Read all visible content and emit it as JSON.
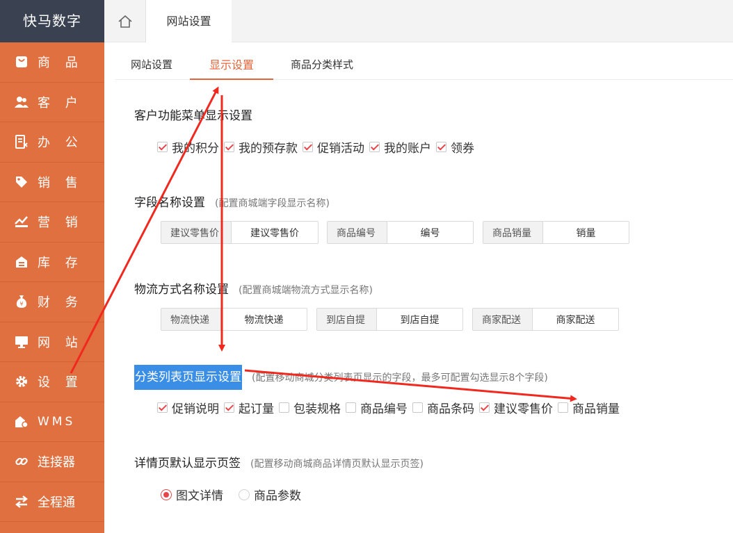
{
  "sidebar": {
    "brand": "快马数字",
    "items": [
      {
        "label": "商 品",
        "icon": "bag-icon"
      },
      {
        "label": "客 户",
        "icon": "users-icon"
      },
      {
        "label": "办 公",
        "icon": "document-icon"
      },
      {
        "label": "销 售",
        "icon": "tag-icon"
      },
      {
        "label": "营 销",
        "icon": "trend-chart-icon"
      },
      {
        "label": "库 存",
        "icon": "warehouse-icon"
      },
      {
        "label": "财 务",
        "icon": "money-bag-icon"
      },
      {
        "label": "网 站",
        "icon": "monitor-icon"
      },
      {
        "label": "设 置",
        "icon": "gear-icon"
      },
      {
        "label": "WMS",
        "icon": "wms-icon"
      },
      {
        "label": "连接器",
        "icon": "link-icon"
      },
      {
        "label": "全程通",
        "icon": "swap-icon"
      }
    ]
  },
  "topbar": {
    "page_tab": "网站设置"
  },
  "subtabs": [
    {
      "label": "网站设置",
      "active": false
    },
    {
      "label": "显示设置",
      "active": true
    },
    {
      "label": "商品分类样式",
      "active": false
    }
  ],
  "sections": {
    "customer_menu": {
      "title": "客户功能菜单显示设置",
      "options": [
        {
          "label": "我的积分",
          "checked": true
        },
        {
          "label": "我的预存款",
          "checked": true
        },
        {
          "label": "促销活动",
          "checked": true
        },
        {
          "label": "我的账户",
          "checked": true
        },
        {
          "label": "领券",
          "checked": true
        }
      ]
    },
    "field_names": {
      "title": "字段名称设置",
      "note": "(配置商城端字段显示名称)",
      "fields": [
        {
          "label": "建议零售价",
          "value": "建议零售价"
        },
        {
          "label": "商品编号",
          "value": "编号"
        },
        {
          "label": "商品销量",
          "value": "销量"
        }
      ]
    },
    "logistics_names": {
      "title": "物流方式名称设置",
      "note": "(配置商城端物流方式显示名称)",
      "fields": [
        {
          "label": "物流快递",
          "value": "物流快递"
        },
        {
          "label": "到店自提",
          "value": "到店自提"
        },
        {
          "label": "商家配送",
          "value": "商家配送"
        }
      ]
    },
    "category_list": {
      "title": "分类列表页显示设置",
      "note": "(配置移动商城分类列表页显示的字段，最多可配置勾选显示8个字段)",
      "options": [
        {
          "label": "促销说明",
          "checked": true
        },
        {
          "label": "起订量",
          "checked": true
        },
        {
          "label": "包装规格",
          "checked": false
        },
        {
          "label": "商品编号",
          "checked": false
        },
        {
          "label": "商品条码",
          "checked": false
        },
        {
          "label": "建议零售价",
          "checked": true
        },
        {
          "label": "商品销量",
          "checked": false
        }
      ]
    },
    "detail_tab": {
      "title": "详情页默认显示页签",
      "note": "(配置移动商城商品详情页默认显示页签)",
      "options": [
        {
          "label": "图文详情",
          "selected": true
        },
        {
          "label": "商品参数",
          "selected": false
        }
      ]
    }
  },
  "colors": {
    "sidebar_bg": "#e07040",
    "brand_bg": "#3a4150",
    "accent": "#e3643a",
    "check": "#e8454a",
    "highlight": "#3a8ee6",
    "annotation_arrow": "#f0281e"
  }
}
